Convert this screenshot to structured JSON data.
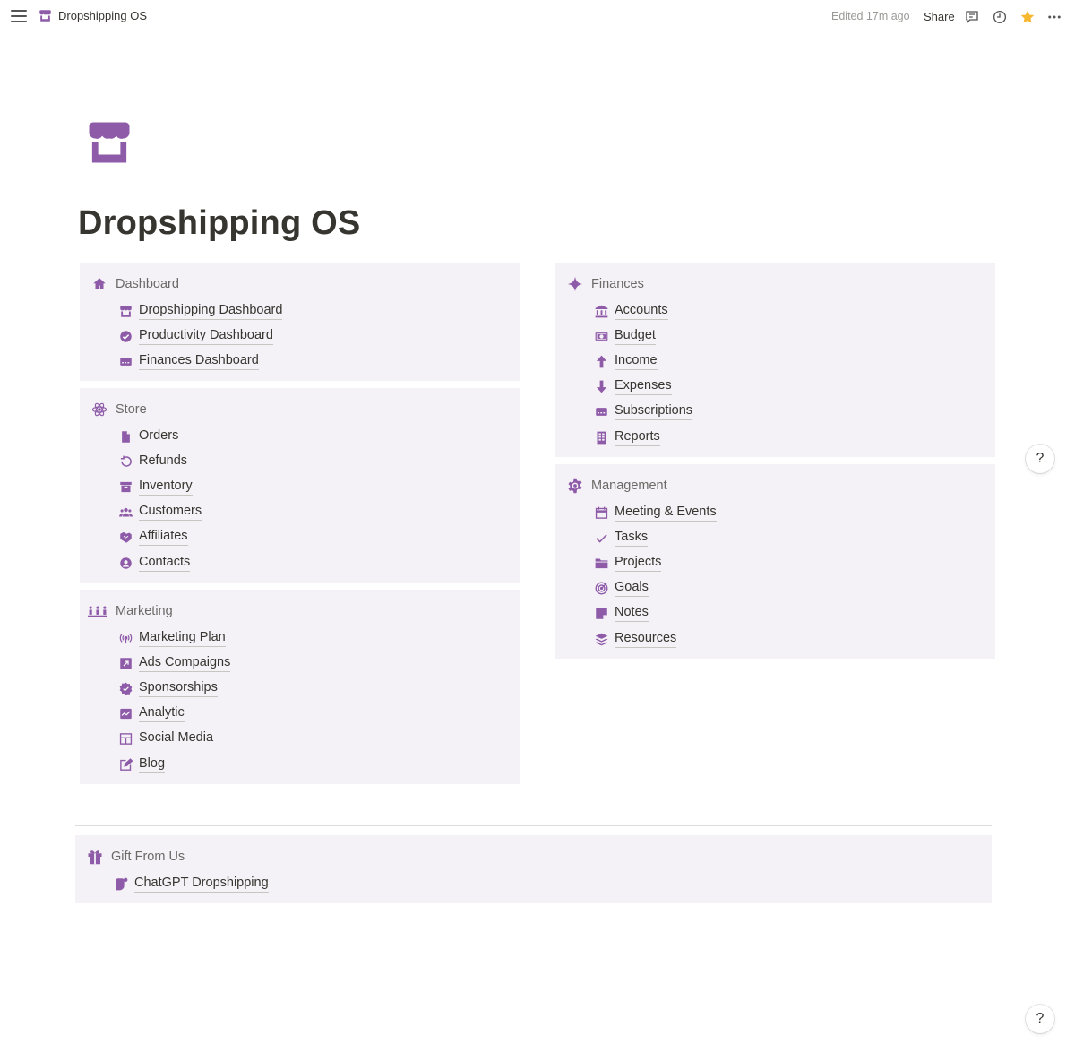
{
  "topbar": {
    "breadcrumb": "Dropshipping OS",
    "edited": "Edited 17m ago",
    "share": "Share",
    "icons": [
      "menu-icon",
      "comment-icon",
      "history-icon",
      "star-icon",
      "more-icon"
    ]
  },
  "page": {
    "icon": "store-icon",
    "title": "Dropshipping OS"
  },
  "colors": {
    "accent": "#8e5ba8",
    "card_bg": "#f4f1f7",
    "star": "#f5b82e"
  },
  "sections": {
    "dashboard": {
      "title": "Dashboard",
      "icon": "home-icon",
      "items": [
        {
          "label": "Dropshipping Dashboard",
          "icon": "store-icon"
        },
        {
          "label": "Productivity Dashboard",
          "icon": "check-circle-icon"
        },
        {
          "label": "Finances Dashboard",
          "icon": "card-icon"
        }
      ]
    },
    "store": {
      "title": "Store",
      "icon": "atom-icon",
      "items": [
        {
          "label": "Orders",
          "icon": "document-icon"
        },
        {
          "label": "Refunds",
          "icon": "undo-icon"
        },
        {
          "label": "Inventory",
          "icon": "archive-icon"
        },
        {
          "label": "Customers",
          "icon": "people-icon"
        },
        {
          "label": "Affiliates",
          "icon": "handshake-icon"
        },
        {
          "label": "Contacts",
          "icon": "user-circle-icon"
        }
      ]
    },
    "marketing": {
      "title": "Marketing",
      "icon": "audience-icon",
      "items": [
        {
          "label": "Marketing Plan",
          "icon": "broadcast-icon"
        },
        {
          "label": "Ads Compaigns",
          "icon": "arrow-box-icon"
        },
        {
          "label": "Sponsorships",
          "icon": "verified-icon"
        },
        {
          "label": "Analytic",
          "icon": "chart-icon"
        },
        {
          "label": "Social Media",
          "icon": "layout-icon"
        },
        {
          "label": "Blog",
          "icon": "edit-icon"
        }
      ]
    },
    "finances": {
      "title": "Finances",
      "icon": "sparkle-icon",
      "items": [
        {
          "label": "Accounts",
          "icon": "bank-icon"
        },
        {
          "label": "Budget",
          "icon": "money-icon"
        },
        {
          "label": "Income",
          "icon": "arrow-up-icon"
        },
        {
          "label": "Expenses",
          "icon": "arrow-down-icon"
        },
        {
          "label": "Subscriptions",
          "icon": "card-icon"
        },
        {
          "label": "Reports",
          "icon": "report-icon"
        }
      ]
    },
    "management": {
      "title": "Management",
      "icon": "gear-icon",
      "items": [
        {
          "label": "Meeting & Events",
          "icon": "calendar-icon"
        },
        {
          "label": "Tasks",
          "icon": "checkmark-icon"
        },
        {
          "label": "Projects",
          "icon": "folder-icon"
        },
        {
          "label": "Goals",
          "icon": "target-icon"
        },
        {
          "label": "Notes",
          "icon": "note-icon"
        },
        {
          "label": "Resources",
          "icon": "stack-icon"
        }
      ]
    },
    "gift": {
      "title": "Gift From Us",
      "icon": "gift-icon",
      "items": [
        {
          "label": "ChatGPT Dropshipping",
          "icon": "chat-icon"
        }
      ]
    }
  },
  "help_label": "?"
}
